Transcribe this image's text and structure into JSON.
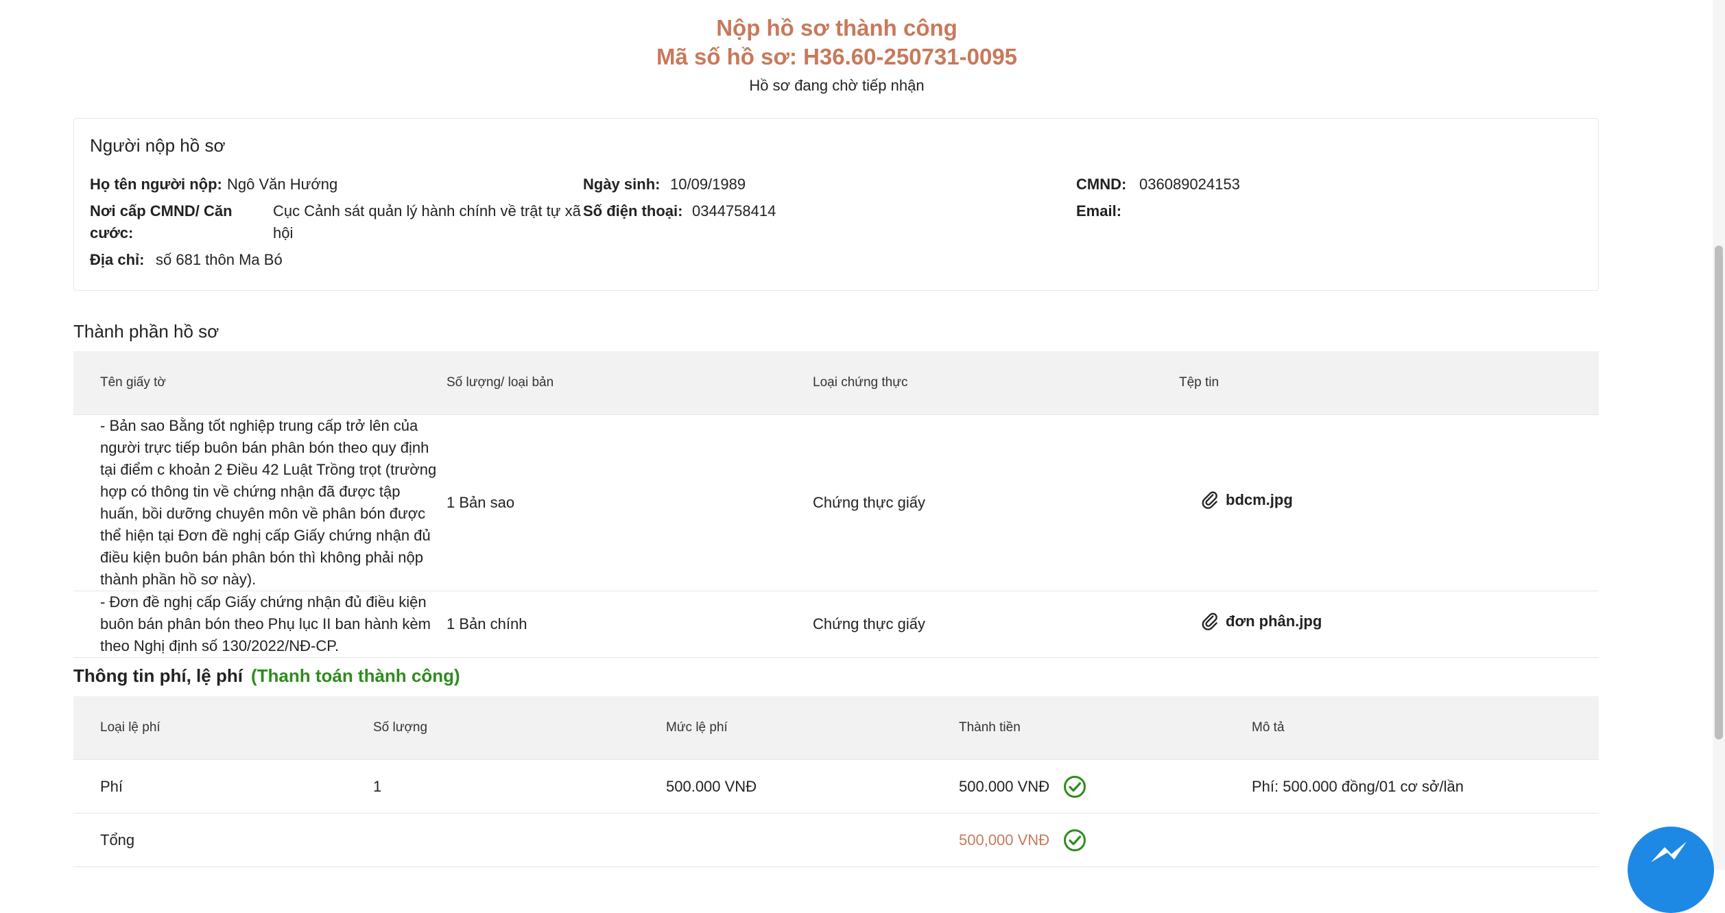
{
  "header": {
    "title": "Nộp hồ sơ thành công",
    "code": "Mã số hồ sơ: H36.60-250731-0095",
    "status": "Hồ sơ đang chờ tiếp nhận"
  },
  "applicant": {
    "title": "Người nộp hồ sơ",
    "name_label": "Họ tên người nộp:",
    "name": "Ngô Văn Hướng",
    "dob_label": "Ngày sinh:",
    "dob": "10/09/1989",
    "id_label": "CMND:",
    "id": "036089024153",
    "issuer_label": "Nơi cấp CMND/ Căn cước:",
    "issuer": "Cục Cảnh sát quản lý hành chính về trật tự xã hội",
    "phone_label": "Số điện thoại:",
    "phone": "0344758414",
    "email_label": "Email:",
    "email": "",
    "address_label": "Địa chỉ:",
    "address": "số 681 thôn Ma Bó"
  },
  "documents": {
    "title": "Thành phần hồ sơ",
    "headers": [
      "Tên giấy tờ",
      "Số lượng/ loại bản",
      "Loại chứng thực",
      "Tệp tin"
    ],
    "rows": [
      {
        "name": "- Bản sao Bằng tốt nghiệp trung cấp trở lên của người trực tiếp buôn bán phân bón theo quy định tại điểm c khoản 2 Điều 42 Luật Trồng trọt (trường hợp có thông tin về chứng nhận đã được tập huấn, bồi dưỡng chuyên môn về phân bón được thể hiện tại Đơn đề nghị cấp Giấy chứng nhận đủ điều kiện buôn bán phân bón thì không phải nộp thành phần hồ sơ này).",
        "quantity": "1 Bản sao",
        "cert": "Chứng thực giấy",
        "file": "bdcm.jpg"
      },
      {
        "name": "- Đơn đề nghị cấp Giấy chứng nhận đủ điều kiện buôn bán phân bón theo Phụ lục II ban hành kèm theo Nghị định số 130/2022/NĐ-CP.",
        "quantity": "1 Bản chính",
        "cert": "Chứng thực giấy",
        "file": "đơn phân.jpg"
      }
    ]
  },
  "fees": {
    "title": "Thông tin phí, lệ phí",
    "status": "(Thanh toán thành công)",
    "headers": [
      "Loại lệ phí",
      "Số lượng",
      "Mức lệ phí",
      "Thành tiền",
      "Mô tả"
    ],
    "rows": [
      {
        "type": "Phí",
        "quantity": "1",
        "rate": "500.000 VNĐ",
        "amount": "500.000 VNĐ",
        "desc": "Phí: 500.000 đồng/01 cơ sở/lần"
      }
    ],
    "total_label": "Tổng",
    "total": "500,000 VNĐ"
  },
  "colors": {
    "accent": "#c8795a",
    "success": "#2e8b1e",
    "messenger": "#1e88e5"
  }
}
